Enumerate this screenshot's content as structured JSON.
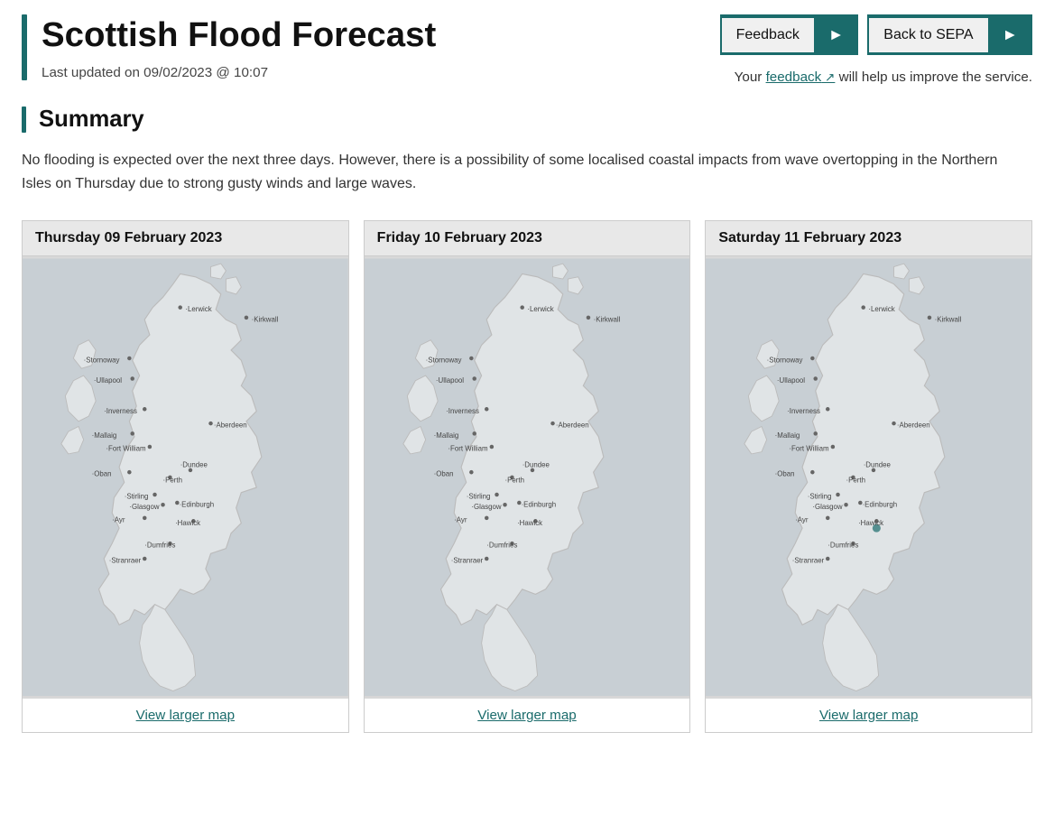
{
  "header": {
    "title": "Scottish Flood Forecast",
    "last_updated": "Last updated on 09/02/2023 @ 10:07",
    "feedback_btn_label": "Feedback",
    "back_btn_label": "Back to SEPA",
    "feedback_note_prefix": "Your ",
    "feedback_link_text": "feedback",
    "feedback_note_suffix": " will help us improve the service."
  },
  "summary": {
    "section_title": "Summary",
    "text": "No flooding is expected over the next three days. However, there is a possibility of some localised coastal impacts from wave overtopping in the Northern Isles on Thursday due to strong gusty winds and large waves."
  },
  "forecast_cards": [
    {
      "id": "thursday",
      "date_label": "Thursday 09 February 2023",
      "view_map_label": "View larger map"
    },
    {
      "id": "friday",
      "date_label": "Friday 10 February 2023",
      "view_map_label": "View larger map"
    },
    {
      "id": "saturday",
      "date_label": "Saturday 11 February 2023",
      "view_map_label": "View larger map"
    }
  ],
  "colors": {
    "accent": "#1a6b6b",
    "map_bg": "#c8cfd4",
    "land": "#e0e4e6",
    "water": "#aec6cf"
  }
}
